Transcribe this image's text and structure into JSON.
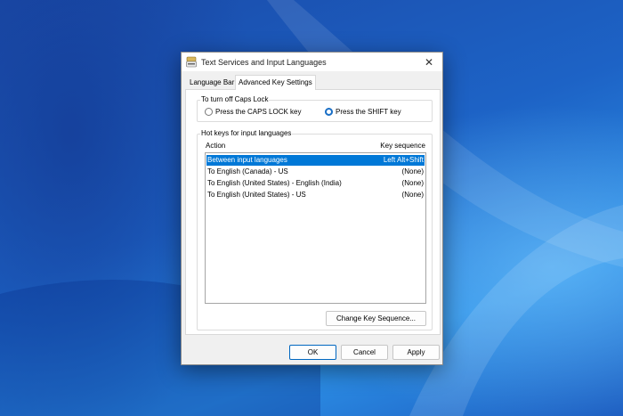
{
  "window": {
    "title": "Text Services and Input Languages",
    "close_glyph": "✕"
  },
  "tabs": [
    {
      "label": "Language Bar",
      "selected": false
    },
    {
      "label": "Advanced Key Settings",
      "selected": true
    }
  ],
  "caps_lock": {
    "group_label": "To turn off Caps Lock",
    "options": [
      {
        "label": "Press the CAPS LOCK key",
        "selected": false
      },
      {
        "label": "Press the SHIFT key",
        "selected": true
      }
    ]
  },
  "hotkeys": {
    "group_label": "Hot keys for input languages",
    "columns": [
      "Action",
      "Key sequence"
    ],
    "rows": [
      {
        "action": "Between input languages",
        "sequence": "Left Alt+Shift",
        "selected": true
      },
      {
        "action": "To English (Canada) - US",
        "sequence": "(None)",
        "selected": false
      },
      {
        "action": "To English (United States) - English (India)",
        "sequence": "(None)",
        "selected": false
      },
      {
        "action": "To English (United States) - US",
        "sequence": "(None)",
        "selected": false
      }
    ],
    "change_button": "Change Key Sequence..."
  },
  "footer": {
    "ok": "OK",
    "cancel": "Cancel",
    "apply": "Apply"
  },
  "colors": {
    "accent": "#0078d7",
    "desktop": "#1554b3"
  }
}
